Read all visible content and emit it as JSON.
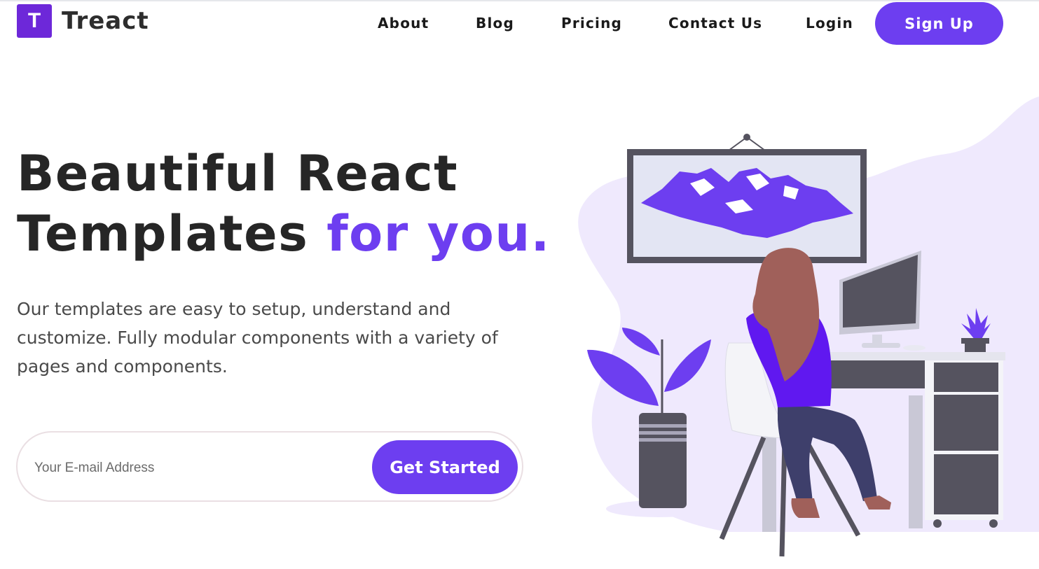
{
  "brand": {
    "logo_letter": "T",
    "name": "Treact",
    "accent_color": "#6d3ef0"
  },
  "nav": {
    "links": [
      "About",
      "Blog",
      "Pricing",
      "Contact Us",
      "Login"
    ],
    "signup_label": "Sign Up"
  },
  "hero": {
    "title_line1": "Beautiful React",
    "title_line2": "Templates",
    "title_accent": "for you.",
    "description": "Our templates are easy to setup, understand and customize. Fully modular components with a variety of pages and components.",
    "email_placeholder": "Your E-mail Address",
    "cta_label": "Get Started"
  },
  "illustration": {
    "icon": "woman-at-desk-illustration"
  }
}
